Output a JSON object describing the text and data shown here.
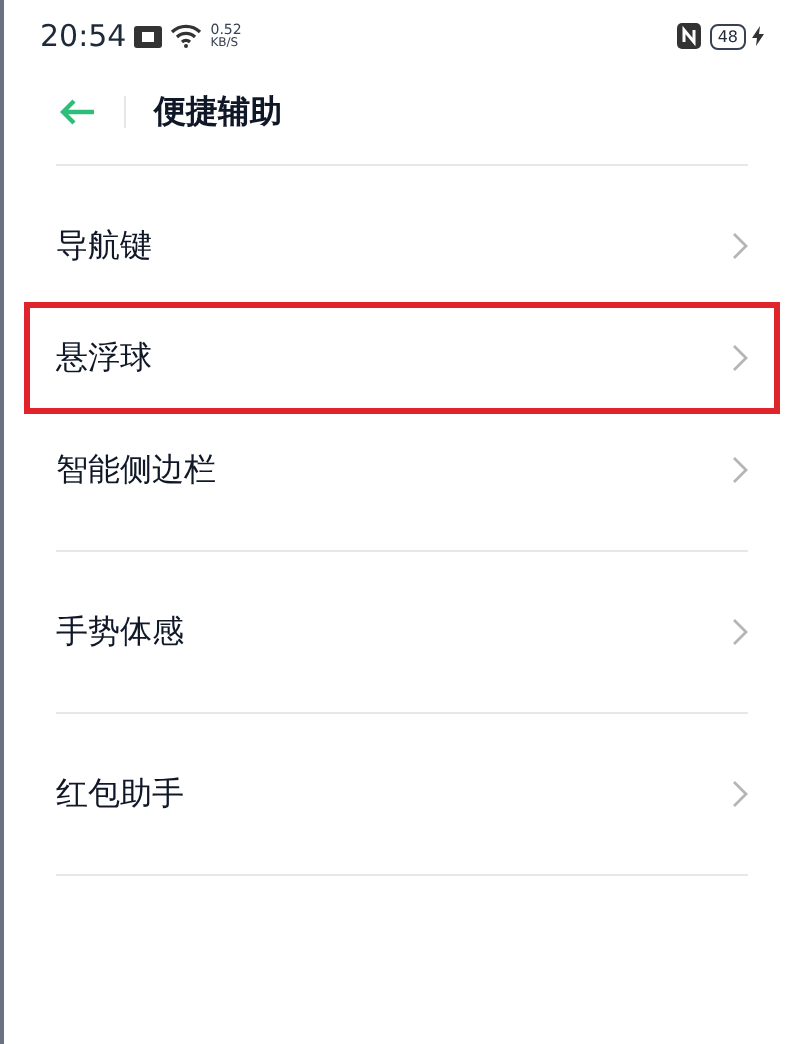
{
  "status_bar": {
    "time": "20:54",
    "net_speed": "0.52",
    "net_unit": "KB/S",
    "battery": "48",
    "charging": true
  },
  "header": {
    "title": "便捷辅助"
  },
  "groups": [
    {
      "items": [
        {
          "label": "导航键",
          "highlighted": false
        },
        {
          "label": "悬浮球",
          "highlighted": true
        },
        {
          "label": "智能侧边栏",
          "highlighted": false
        }
      ]
    },
    {
      "items": [
        {
          "label": "手势体感",
          "highlighted": false
        }
      ]
    },
    {
      "items": [
        {
          "label": "红包助手",
          "highlighted": false
        }
      ]
    }
  ]
}
